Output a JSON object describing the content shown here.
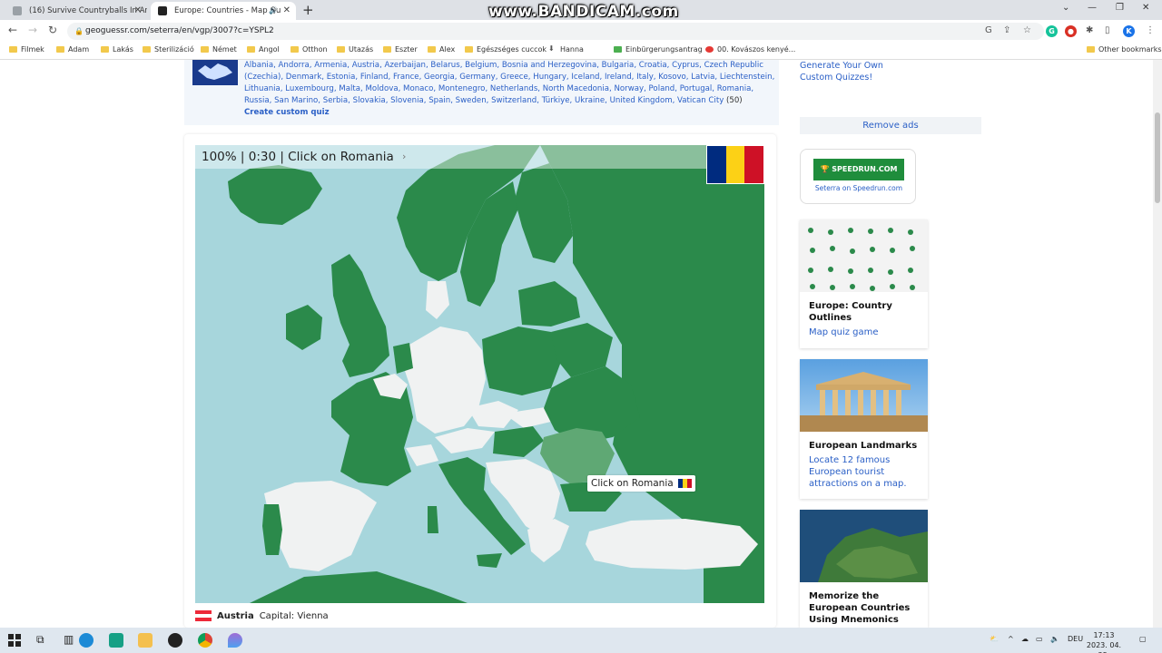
{
  "browser": {
    "tabs": [
      {
        "title": "(16) Survive Countryballs In Area",
        "active": false
      },
      {
        "title": "Europe: Countries - Map Qu",
        "active": true
      }
    ],
    "watermark": "www.BANDICAM.com",
    "url": "geoguessr.com/seterra/en/vgp/3007?c=YSPL2",
    "bookmarks": [
      "Filmek",
      "Adam",
      "Lakás",
      "Sterilizáció",
      "Német",
      "Angol",
      "Otthon",
      "Utazás",
      "Eszter",
      "Alex",
      "Egészséges cuccok",
      "Hanna",
      "Einbürgerungsantrag",
      "00. Kovászos kenyé...",
      "Other bookmarks"
    ],
    "profile_initial": "K"
  },
  "countries_list": {
    "text": "Albania, Andorra, Armenia, Austria, Azerbaijan, Belarus, Belgium, Bosnia and Herzegovina, Bulgaria, Croatia, Cyprus, Czech Republic (Czechia), Denmark, Estonia, Finland, France, Georgia, Germany, Greece, Hungary, Iceland, Ireland, Italy, Kosovo, Latvia, Liechtenstein, Lithuania, Luxembourg, Malta, Moldova, Monaco, Montenegro, Netherlands, North Macedonia, Norway, Poland, Portugal, Romania, Russia, San Marino, Serbia, Slovakia, Slovenia, Spain, Sweden, Switzerland, Türkiye, Ukraine, United Kingdom, Vatican City",
    "count": "(50)",
    "custom_link": "Create custom quiz"
  },
  "game": {
    "status": "100% | 0:30 | Click on Romania",
    "next_arrow": "›",
    "tooltip": "Click on Romania",
    "target_flag": [
      "#002B7F",
      "#FCD116",
      "#CE1126"
    ],
    "last_answer": {
      "country": "Austria",
      "capital": "Capital: Vienna",
      "flag": [
        "#ED2939",
        "#FFFFFF",
        "#ED2939"
      ]
    },
    "colors": {
      "sea": "#a7d6dc",
      "done": "#2b8a4b",
      "pending": "#f0f2f2",
      "target": "#5fa874",
      "border": "#9fcfa8"
    }
  },
  "sidebar": {
    "generate_link": "Generate Your Own Custom Quizzes!",
    "remove_ads": "Remove ads",
    "speedrun_logo": "SPEEDRUN.COM",
    "speedrun_caption": "Seterra on Speedrun.com",
    "promos": [
      {
        "title": "Europe: Country Outlines",
        "desc": "Map quiz game"
      },
      {
        "title": "European Landmarks",
        "desc": "Locate 12 famous European tourist attractions on a map."
      },
      {
        "title": "Memorize the European Countries Using Mnemonics",
        "desc": ""
      }
    ]
  },
  "taskbar": {
    "language": "DEU",
    "time": "17:13",
    "date": "2023. 04. 25."
  }
}
